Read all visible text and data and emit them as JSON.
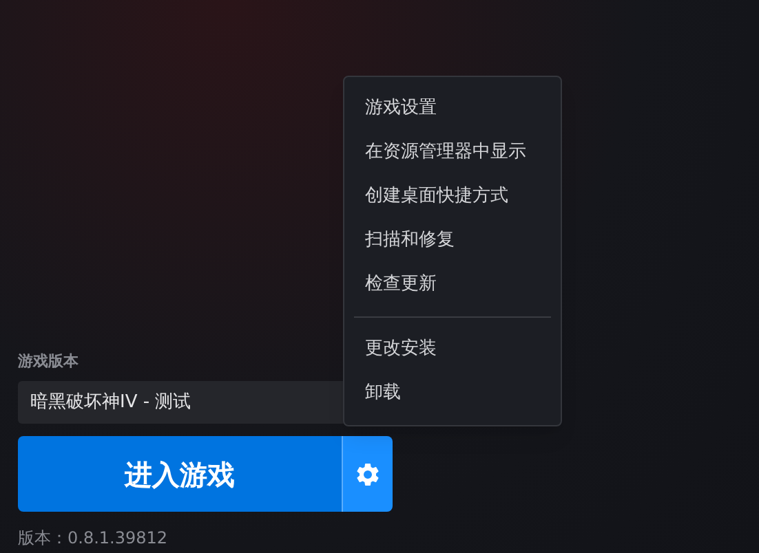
{
  "version_label": "游戏版本",
  "version_select": {
    "value": "暗黑破坏神IV - 测试"
  },
  "play_button": {
    "label": "进入游戏"
  },
  "version_text": "版本：0.8.1.39812",
  "menu": {
    "groups": [
      {
        "items": [
          "游戏设置",
          "在资源管理器中显示",
          "创建桌面快捷方式",
          "扫描和修复",
          "检查更新"
        ]
      },
      {
        "items": [
          "更改安装",
          "卸载"
        ]
      }
    ]
  }
}
